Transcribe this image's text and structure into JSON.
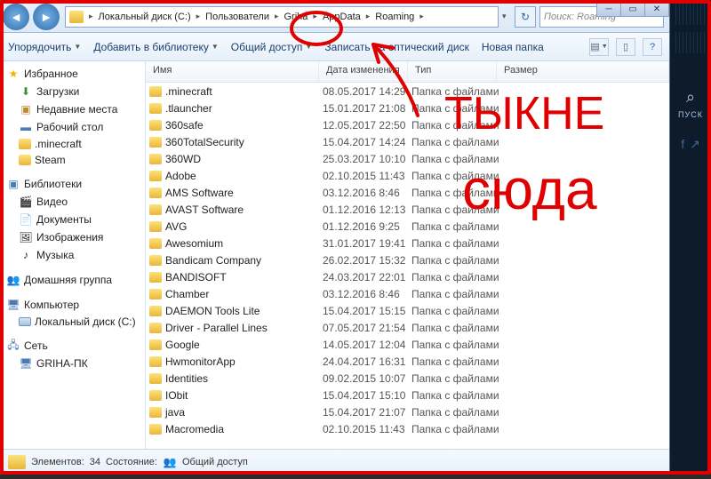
{
  "breadcrumb": [
    "Локальный диск (C:)",
    "Пользователи",
    "Griha",
    "AppData",
    "Roaming"
  ],
  "search_placeholder": "Поиск: Roaming",
  "toolbar": {
    "organize": "Упорядочить",
    "addlib": "Добавить в библиотеку",
    "share": "Общий доступ",
    "burn": "Записать на оптический диск",
    "newfolder": "Новая папка"
  },
  "columns": {
    "name": "Имя",
    "date": "Дата изменения",
    "type": "Тип",
    "size": "Размер"
  },
  "sidebar": {
    "fav_title": "Избранное",
    "fav": [
      "Загрузки",
      "Недавние места",
      "Рабочий стол",
      ".minecraft",
      "Steam"
    ],
    "lib_title": "Библиотеки",
    "lib": [
      "Видео",
      "Документы",
      "Изображения",
      "Музыка"
    ],
    "home_title": "Домашняя группа",
    "comp_title": "Компьютер",
    "comp": [
      "Локальный диск (C:)"
    ],
    "net_title": "Сеть",
    "net": [
      "GRIHA-ПК"
    ]
  },
  "files": [
    {
      "n": ".minecraft",
      "d": "08.05.2017 14:29",
      "t": "Папка с файлами"
    },
    {
      "n": ".tlauncher",
      "d": "15.01.2017 21:08",
      "t": "Папка с файлами"
    },
    {
      "n": "360safe",
      "d": "12.05.2017 22:50",
      "t": "Папка с файлами"
    },
    {
      "n": "360TotalSecurity",
      "d": "15.04.2017 14:24",
      "t": "Папка с файлами"
    },
    {
      "n": "360WD",
      "d": "25.03.2017 10:10",
      "t": "Папка с файлами"
    },
    {
      "n": "Adobe",
      "d": "02.10.2015 11:43",
      "t": "Папка с файлами"
    },
    {
      "n": "AMS Software",
      "d": "03.12.2016 8:46",
      "t": "Папка с файлами"
    },
    {
      "n": "AVAST Software",
      "d": "01.12.2016 12:13",
      "t": "Папка с файлами"
    },
    {
      "n": "AVG",
      "d": "01.12.2016 9:25",
      "t": "Папка с файлами"
    },
    {
      "n": "Awesomium",
      "d": "31.01.2017 19:41",
      "t": "Папка с файлами"
    },
    {
      "n": "Bandicam Company",
      "d": "26.02.2017 15:32",
      "t": "Папка с файлами"
    },
    {
      "n": "BANDISOFT",
      "d": "24.03.2017 22:01",
      "t": "Папка с файлами"
    },
    {
      "n": "Chamber",
      "d": "03.12.2016 8:46",
      "t": "Папка с файлами"
    },
    {
      "n": "DAEMON Tools Lite",
      "d": "15.04.2017 15:15",
      "t": "Папка с файлами"
    },
    {
      "n": "Driver - Parallel Lines",
      "d": "07.05.2017 21:54",
      "t": "Папка с файлами"
    },
    {
      "n": "Google",
      "d": "14.05.2017 12:04",
      "t": "Папка с файлами"
    },
    {
      "n": "HwmonitorApp",
      "d": "24.04.2017 16:31",
      "t": "Папка с файлами"
    },
    {
      "n": "Identities",
      "d": "09.02.2015 10:07",
      "t": "Папка с файлами"
    },
    {
      "n": "IObit",
      "d": "15.04.2017 15:10",
      "t": "Папка с файлами"
    },
    {
      "n": "java",
      "d": "15.04.2017 21:07",
      "t": "Папка с файлами"
    },
    {
      "n": "Macromedia",
      "d": "02.10.2015 11:43",
      "t": "Папка с файлами"
    }
  ],
  "status": {
    "elements_label": "Элементов:",
    "elements_count": "34",
    "state_label": "Состояние:",
    "state_val": "Общий доступ"
  },
  "sideapp": {
    "label": "ПУСК"
  },
  "annotation_text1": "ТЫКНЕ",
  "annotation_text2": "сюда"
}
